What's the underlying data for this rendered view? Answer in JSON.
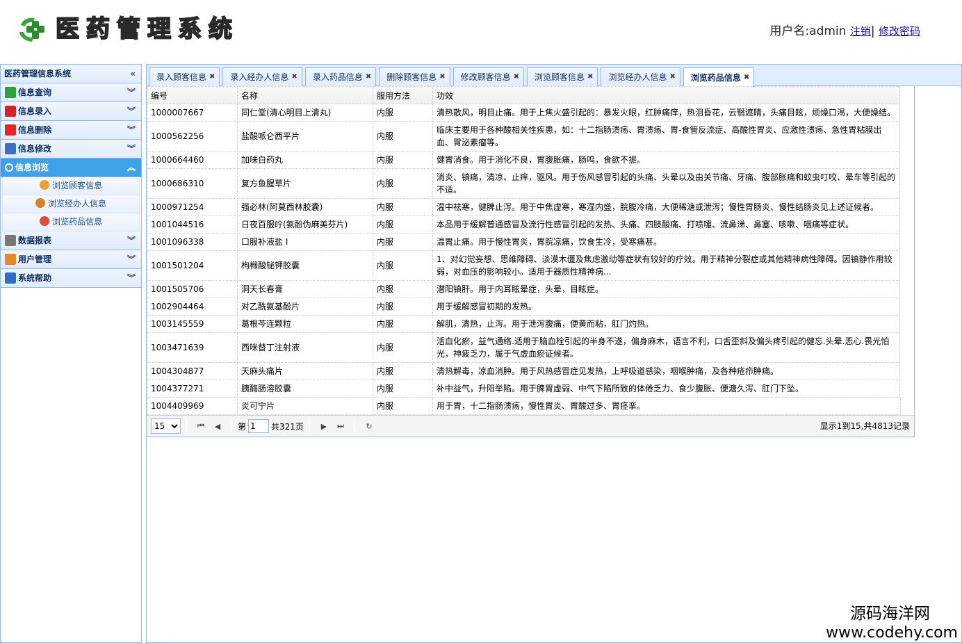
{
  "header": {
    "title_chars": [
      "医",
      "药",
      "管",
      "理",
      "系",
      "统"
    ],
    "user_label": "用户名:admin",
    "logout": "注销",
    "separator": "|",
    "change_password": "修改密码"
  },
  "sidebar": {
    "title": "医药管理信息系统",
    "collapse_icon": "«",
    "items": [
      {
        "label": "信息查询",
        "icon": "query-icon",
        "color": "#2aa33a"
      },
      {
        "label": "信息录入",
        "icon": "add-icon",
        "color": "#d8232a"
      },
      {
        "label": "信息删除",
        "icon": "delete-icon",
        "color": "#e3262b"
      },
      {
        "label": "信息修改",
        "icon": "edit-icon",
        "color": "#3b6fc7"
      },
      {
        "label": "信息浏览",
        "icon": "browse-icon",
        "color": "#ffffff",
        "active": true
      },
      {
        "label": "数据报表",
        "icon": "printer-icon",
        "color": "#777777"
      },
      {
        "label": "用户管理",
        "icon": "user-icon",
        "color": "#e58a2a"
      },
      {
        "label": "系统帮助",
        "icon": "help-icon",
        "color": "#2a6fc7"
      }
    ],
    "sub_items": [
      {
        "label": "浏览顾客信息",
        "icon": "customer-icon"
      },
      {
        "label": "浏览经办人信息",
        "icon": "agent-icon"
      },
      {
        "label": "浏览药品信息",
        "icon": "medicine-icon"
      }
    ]
  },
  "tabs": [
    {
      "label": "录入顾客信息"
    },
    {
      "label": "录入经办人信息"
    },
    {
      "label": "录入药品信息"
    },
    {
      "label": "删除顾客信息"
    },
    {
      "label": "修改顾客信息"
    },
    {
      "label": "浏览顾客信息"
    },
    {
      "label": "浏览经办人信息"
    },
    {
      "label": "浏览药品信息",
      "active": true
    }
  ],
  "table": {
    "columns": [
      "编号",
      "名称",
      "服用方法",
      "功效"
    ],
    "rows": [
      [
        "1000007667",
        "同仁堂(清心明目上清丸)",
        "内服",
        "清热散风，明目止痛。用于上焦火盛引起的：暴发火眼，红肿痛痒，热泪昏花，云翳遮睛，头痛目眩，烦燥口渴，大便燥结。"
      ],
      [
        "1000562256",
        "盐酸哌仑西平片",
        "内服",
        "临床主要用于各种酸相关性疾患，如：十二指肠溃疡、胃溃疡、胃-食管反流症、高酸性胃炎、应激性溃疡、急性胃粘膜出血、胃泌素瘤等。"
      ],
      [
        "1000664460",
        "加味白药丸",
        "内服",
        "健胃消食。用于消化不良，胃腹胀痛，肠鸣，食欲不振。"
      ],
      [
        "1000686310",
        "复方鱼腥草片",
        "内服",
        "消炎、镇痛，清凉、止痒，驱风。用于伤风感冒引起的头痛、头晕以及由关节痛、牙痛、腹部胀痛和蚊虫叮咬、晕车等引起的不适。"
      ],
      [
        "1000971254",
        "强必林(阿莫西林胶囊)",
        "内服",
        "温中祛寒，健脾止泻。用于中焦虚寒，寒湿内盛，脘腹冷痛，大便稀溏或泄泻；慢性胃肠炎、慢性结肠炎见上述证候者。"
      ],
      [
        "1001044516",
        "日夜百服咛(氨酚伪麻美芬片)",
        "内服",
        "本品用于缓解普通感冒及流行性感冒引起的发热、头痛、四肢酸痛、打喷嚏、流鼻涕、鼻塞、咳嗽、咽痛等症状。"
      ],
      [
        "1001096338",
        "口服补液盐 I",
        "内服",
        "温胃止痛。用于慢性胃炎，胃脘凉痛，饮食生冷，受寒痛甚。"
      ],
      [
        "1001501204",
        "枸橼酸铋钾胶囊",
        "内服",
        "1、对幻觉妄想、思维障碍、淡漠木僵及焦虑激动等症状有较好的疗效。用于精神分裂症或其他精神病性障碍。因镇静作用较弱，对血压的影响较小。适用于器质性精神病..."
      ],
      [
        "1001505706",
        "洞天长春膏",
        "内服",
        "潜阳镇肝。用于内耳眩晕症，头晕，目眩症。"
      ],
      [
        "1002904464",
        "对乙酰氨基酚片",
        "内服",
        "用于缓解感冒初期的发热。"
      ],
      [
        "1003145559",
        "葛根芩连颗粒",
        "内服",
        "解肌，清热，止泻。用于泄泻腹痛，便黄而粘，肛门灼热。"
      ],
      [
        "1003471639",
        "西咪替丁注射液",
        "内服",
        "活血化瘀，益气通络.适用于脑血栓引起的半身不遂，偏身麻木，语言不利，口舌歪斜及偏头疼引起的健忘.头晕.恶心.畏光怕光，神疲乏力，属于气虚血瘀证候者。"
      ],
      [
        "1004304877",
        "天麻头痛片",
        "内服",
        "清热解毒，凉血消肿。用于风热感冒症见发热，上呼吸道感染，咽喉肿痛，及各种疮疖肿痛。"
      ],
      [
        "1004377271",
        "胰酶肠溶胶囊",
        "内服",
        "补中益气，升阳举陷。用于脾胃虚弱、中气下陷所致的体倦乏力、食少腹胀、便溏久泻、肛门下坠。"
      ],
      [
        "1004409969",
        "炎可宁片",
        "内服",
        "用于胃，十二指肠溃疡，慢性胃炎、胃酸过多、胃痉挛。"
      ]
    ]
  },
  "pager": {
    "page_size": "15",
    "page_label": "第",
    "page_value": "1",
    "total_pages": "共321页",
    "info": "显示1到15,共4813记录"
  },
  "watermark": {
    "line1": "源码海洋网",
    "line2": "www.codehy.com"
  }
}
